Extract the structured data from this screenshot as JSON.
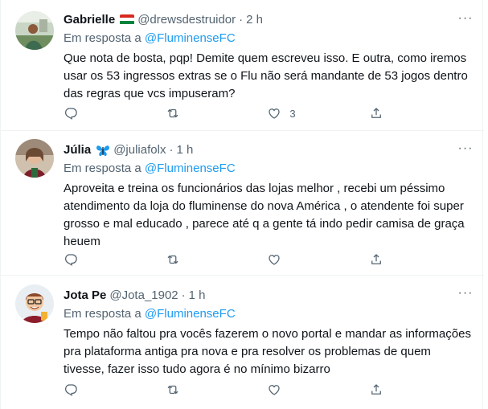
{
  "tweets": [
    {
      "name": "Gabrielle",
      "handle": "@drewsdestruidor",
      "time": "2 h",
      "reply_prefix": "Em resposta a ",
      "reply_to": "@FluminenseFC",
      "text": "Que nota de bosta, pqp! Demite quem escreveu isso. E outra, como iremos usar os 53 ingressos extras se o Flu não será mandante de 53 jogos dentro das regras que vcs impuseram?",
      "reply_count": "",
      "retweet_count": "",
      "like_count": "3",
      "flag_colors": [
        "#d52b1e",
        "#ffffff",
        "#00843d"
      ]
    },
    {
      "name": "Júlia",
      "handle": "@juliafolx",
      "time": "1 h",
      "reply_prefix": "Em resposta a ",
      "reply_to": "@FluminenseFC",
      "text": "Aproveita e treina os funcionários das lojas melhor , recebi um péssimo atendimento da loja do fluminense do nova América , o atendente foi super grosso e mal educado , parece até q a gente tá indo pedir camisa de graça heuem",
      "reply_count": "",
      "retweet_count": "",
      "like_count": ""
    },
    {
      "name": "Jota Pe",
      "handle": "@Jota_1902",
      "time": "1 h",
      "reply_prefix": "Em resposta a ",
      "reply_to": "@FluminenseFC",
      "text": "Tempo não faltou pra vocês fazerem o novo portal e mandar as informações pra plataforma antiga pra nova e pra resolver os problemas de quem tivesse, fazer isso tudo agora é no mínimo bizarro",
      "reply_count": "",
      "retweet_count": "",
      "like_count": ""
    }
  ],
  "dot": "·",
  "more_label": "···",
  "colors": {
    "accent": "#1d9bf0",
    "muted": "#536471",
    "text": "#0f1419",
    "butterfly": "#1d9bf0"
  },
  "icons": [
    "reply-icon",
    "retweet-icon",
    "like-icon",
    "share-icon",
    "more-icon",
    "butterfly-icon",
    "hungary-flag-icon"
  ]
}
